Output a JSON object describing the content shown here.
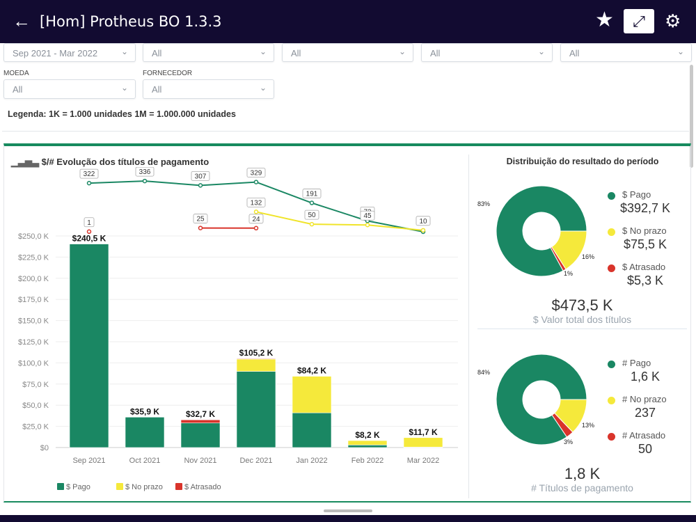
{
  "header": {
    "title": "[Hom] Protheus BO 1.3.3",
    "back_icon": "arrow-left-icon",
    "favorite_icon": "star-icon",
    "expand_icon": "expand-icon",
    "settings_icon": "gear-icon"
  },
  "filters": {
    "row1": [
      {
        "value": "Sep 2021 - Mar 2022"
      },
      {
        "value": "All"
      },
      {
        "value": "All"
      },
      {
        "value": "All"
      },
      {
        "value": "All"
      }
    ],
    "moeda": {
      "label": "MOEDA",
      "value": "All"
    },
    "fornecedor": {
      "label": "FORNECEDOR",
      "value": "All"
    },
    "legend_note": "Legenda: 1K = 1.000 unidades 1M = 1.000.000 unidades"
  },
  "colors": {
    "pago": "#1a8763",
    "no_prazo": "#f5e93b",
    "atrasado": "#d9342b",
    "header": "#120b31"
  },
  "chart_data": [
    {
      "type": "bar",
      "title": "$/# Evolução dos títulos de pagamento",
      "categories": [
        "Sep 2021",
        "Oct 2021",
        "Nov 2021",
        "Dec 2021",
        "Jan 2022",
        "Feb 2022",
        "Mar 2022"
      ],
      "stacked": true,
      "ylim": [
        0,
        250
      ],
      "y_ticks": [
        "$0",
        "$25,0 K",
        "$50,0 K",
        "$75,0 K",
        "$100,0 K",
        "$125,0 K",
        "$150,0 K",
        "$175,0 K",
        "$200,0 K",
        "$225,0 K",
        "$250,0 K"
      ],
      "grid": true,
      "legend_placement": "bottom-left",
      "series": [
        {
          "name": "$ Pago",
          "values": [
            240.5,
            35.9,
            29.0,
            90.0,
            41.0,
            3.0,
            0.5
          ]
        },
        {
          "name": "$ No prazo",
          "values": [
            0,
            0,
            0,
            14.5,
            43.2,
            5.2,
            11.2
          ]
        },
        {
          "name": "$ Atrasado",
          "values": [
            0,
            0,
            3.7,
            0.7,
            0,
            0,
            0
          ]
        }
      ],
      "totals_labels": [
        "$240,5 K",
        "$35,9 K",
        "$32,7 K",
        "$105,2 K",
        "$84,2 K",
        "$8,2 K",
        "$11,7 K"
      ],
      "line_series": [
        {
          "name": "# Pago",
          "values": [
            322,
            336,
            307,
            329,
            191,
            72,
            0
          ],
          "labels": [
            "322",
            "336",
            "307",
            "329",
            "191",
            "72",
            ""
          ]
        },
        {
          "name": "# No prazo",
          "values": [
            null,
            null,
            null,
            132,
            50,
            45,
            10
          ],
          "labels": [
            "",
            "",
            "",
            "132",
            "50",
            "45",
            "10"
          ]
        },
        {
          "name": "# Atrasado",
          "values": [
            1,
            null,
            25,
            24,
            null,
            null,
            null
          ],
          "labels": [
            "1",
            "",
            "25",
            "24",
            "",
            "",
            ""
          ]
        }
      ]
    },
    {
      "type": "pie",
      "title": "Distribuição do resultado do período",
      "slices": [
        {
          "name": "$ Pago",
          "value": 392.7,
          "label": "$392,7 K",
          "pct": "83%"
        },
        {
          "name": "$ No prazo",
          "value": 75.5,
          "label": "$75,5 K",
          "pct": "16%"
        },
        {
          "name": "$ Atrasado",
          "value": 5.3,
          "label": "$5,3 K",
          "pct": "1%"
        }
      ],
      "total": "$473,5 K",
      "total_caption": "$ Valor total dos títulos"
    },
    {
      "type": "pie",
      "slices": [
        {
          "name": "# Pago",
          "value": 1557,
          "label": "1,6 K",
          "pct": "84%"
        },
        {
          "name": "# No prazo",
          "value": 237,
          "label": "237",
          "pct": "13%"
        },
        {
          "name": "# Atrasado",
          "value": 50,
          "label": "50",
          "pct": "3%"
        }
      ],
      "total": "1,8 K",
      "total_caption": "# Títulos de pagamento"
    }
  ]
}
